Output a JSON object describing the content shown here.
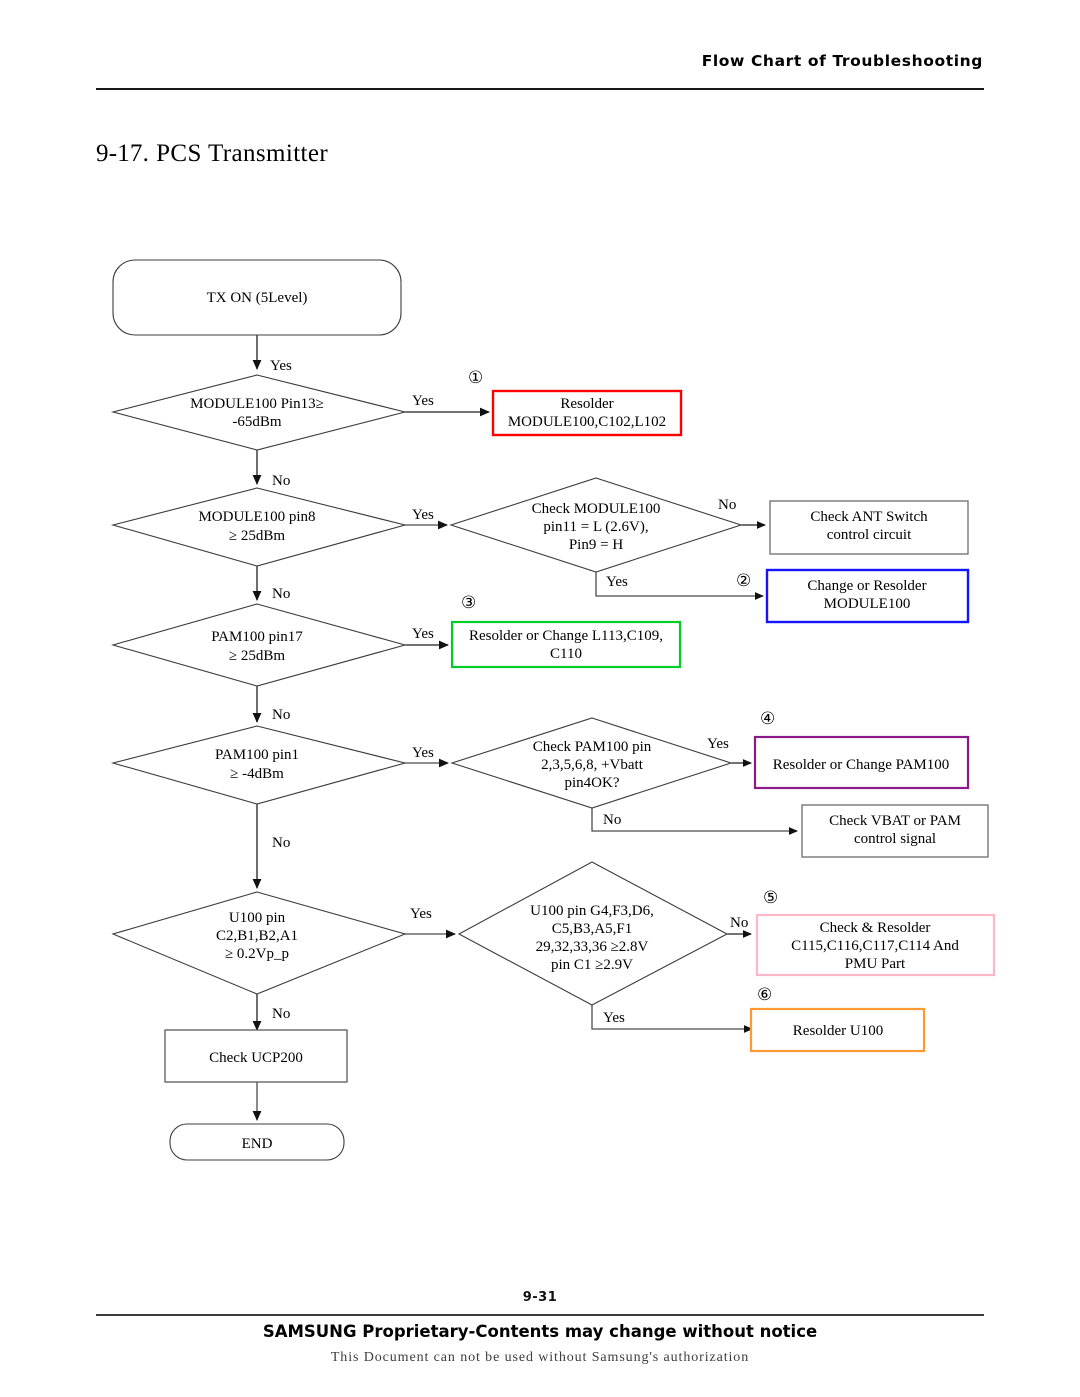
{
  "header": {
    "title": "Flow Chart of Troubleshooting"
  },
  "section": {
    "number": "9-17.",
    "title": "PCS Transmitter"
  },
  "footer": {
    "page_number": "9-31",
    "proprietary": "SAMSUNG Proprietary-Contents may change without notice",
    "authorization": "This Document can not be used without Samsung's authorization"
  },
  "chart_data": {
    "type": "diagram",
    "title": "PCS Transmitter troubleshooting flow chart",
    "nodes": [
      {
        "id": "start",
        "shape": "terminator",
        "lines": [
          "TX ON (5Level)"
        ]
      },
      {
        "id": "d1",
        "shape": "decision",
        "lines": [
          "MODULE100 Pin13≥",
          "-65dBm"
        ]
      },
      {
        "id": "d2",
        "shape": "decision",
        "lines": [
          "MODULE100 pin8",
          "≥ 25dBm"
        ]
      },
      {
        "id": "d3",
        "shape": "decision",
        "lines": [
          "PAM100 pin17",
          "≥ 25dBm"
        ]
      },
      {
        "id": "d4",
        "shape": "decision",
        "lines": [
          "PAM100 pin1",
          "≥ -4dBm"
        ]
      },
      {
        "id": "d5",
        "shape": "decision",
        "lines": [
          "U100 pin",
          "C2,B1,B2,A1",
          "≥ 0.2Vp_p"
        ]
      },
      {
        "id": "dm1",
        "shape": "decision",
        "lines": [
          "Check MODULE100",
          "pin11 = L (2.6V),",
          "Pin9 = H"
        ]
      },
      {
        "id": "dm2",
        "shape": "decision",
        "lines": [
          "Check PAM100 pin",
          "2,3,5,6,8, +Vbatt",
          "pin4OK?"
        ]
      },
      {
        "id": "dm3",
        "shape": "decision",
        "lines": [
          "U100 pin G4,F3,D6,",
          "C5,B3,A5,F1",
          "29,32,33,36 ≥2.8V",
          "pin C1 ≥2.9V"
        ]
      },
      {
        "id": "r1",
        "shape": "process",
        "lines": [
          "Resolder",
          "MODULE100,C102,L102"
        ],
        "color": "#ff0000",
        "marker": "①"
      },
      {
        "id": "ant",
        "shape": "process",
        "lines": [
          "Check ANT Switch",
          "control circuit"
        ],
        "color": "#555555"
      },
      {
        "id": "r2",
        "shape": "process",
        "lines": [
          "Change or Resolder",
          "MODULE100"
        ],
        "color": "#1414ff",
        "marker": "②"
      },
      {
        "id": "r3",
        "shape": "process",
        "lines": [
          "Resolder or Change L113,C109,",
          "C110"
        ],
        "color": "#00cc2a",
        "marker": "③"
      },
      {
        "id": "r4",
        "shape": "process",
        "lines": [
          "Resolder or Change PAM100"
        ],
        "color": "#8a1a8a",
        "marker": "④"
      },
      {
        "id": "vbat",
        "shape": "process",
        "lines": [
          "Check VBAT or PAM",
          "control signal"
        ],
        "color": "#555555"
      },
      {
        "id": "r5",
        "shape": "process",
        "lines": [
          "Check & Resolder",
          "C115,C116,C117,C114 And",
          "PMU Part"
        ],
        "color": "#ffb6c8",
        "marker": "⑤"
      },
      {
        "id": "r6",
        "shape": "process",
        "lines": [
          "Resolder U100"
        ],
        "color": "#ff9933",
        "marker": "⑥"
      },
      {
        "id": "ucp",
        "shape": "process",
        "lines": [
          "Check UCP200"
        ],
        "color": "#555555"
      },
      {
        "id": "end",
        "shape": "terminator",
        "lines": [
          "END"
        ]
      }
    ],
    "edges": [
      {
        "from": "start",
        "to": "d1",
        "label": "Yes"
      },
      {
        "from": "d1",
        "to": "r1",
        "label": "Yes"
      },
      {
        "from": "d1",
        "to": "d2",
        "label": "No"
      },
      {
        "from": "d2",
        "to": "dm1",
        "label": "Yes"
      },
      {
        "from": "d2",
        "to": "d3",
        "label": "No"
      },
      {
        "from": "dm1",
        "to": "ant",
        "label": "No"
      },
      {
        "from": "dm1",
        "to": "r2",
        "label": "Yes"
      },
      {
        "from": "d3",
        "to": "r3",
        "label": "Yes"
      },
      {
        "from": "d3",
        "to": "d4",
        "label": "No"
      },
      {
        "from": "d4",
        "to": "dm2",
        "label": "Yes"
      },
      {
        "from": "d4",
        "to": "d5",
        "label": "No"
      },
      {
        "from": "dm2",
        "to": "r4",
        "label": "Yes"
      },
      {
        "from": "dm2",
        "to": "vbat",
        "label": "No"
      },
      {
        "from": "d5",
        "to": "dm3",
        "label": "Yes"
      },
      {
        "from": "d5",
        "to": "ucp",
        "label": "No"
      },
      {
        "from": "dm3",
        "to": "r5",
        "label": "No"
      },
      {
        "from": "dm3",
        "to": "r6",
        "label": "Yes"
      },
      {
        "from": "ucp",
        "to": "end",
        "label": ""
      }
    ],
    "markers": [
      "①",
      "②",
      "③",
      "④",
      "⑤",
      "⑥"
    ]
  },
  "nodes": {
    "start": {
      "l0": "TX ON (5Level)"
    },
    "d1": {
      "l0": "MODULE100 Pin13≥",
      "l1": "-65dBm"
    },
    "d2": {
      "l0": "MODULE100 pin8",
      "l1": "≥ 25dBm"
    },
    "d3": {
      "l0": "PAM100 pin17",
      "l1": "≥ 25dBm"
    },
    "d4": {
      "l0": "PAM100 pin1",
      "l1": "≥ -4dBm"
    },
    "d5": {
      "l0": "U100 pin",
      "l1": "C2,B1,B2,A1",
      "l2": "≥ 0.2Vp_p"
    },
    "dm1": {
      "l0": "Check MODULE100",
      "l1": "pin11 = L (2.6V),",
      "l2": "Pin9 = H"
    },
    "dm2": {
      "l0": "Check PAM100 pin",
      "l1": "2,3,5,6,8, +Vbatt",
      "l2": "pin4OK?"
    },
    "dm3": {
      "l0": "U100 pin G4,F3,D6,",
      "l1": "C5,B3,A5,F1",
      "l2": "29,32,33,36 ≥2.8V",
      "l3": "pin C1 ≥2.9V"
    },
    "r1": {
      "l0": "Resolder",
      "l1": "MODULE100,C102,L102"
    },
    "ant": {
      "l0": "Check ANT Switch",
      "l1": "control circuit"
    },
    "r2": {
      "l0": "Change or Resolder",
      "l1": "MODULE100"
    },
    "r3": {
      "l0": "Resolder or Change L113,C109,",
      "l1": "C110"
    },
    "r4": {
      "l0": "Resolder or Change PAM100"
    },
    "vbat": {
      "l0": "Check VBAT or PAM",
      "l1": "control signal"
    },
    "r5": {
      "l0": "Check & Resolder",
      "l1": "C115,C116,C117,C114 And",
      "l2": "PMU Part"
    },
    "r6": {
      "l0": "Resolder U100"
    },
    "ucp": {
      "l0": "Check UCP200"
    },
    "end": {
      "l0": "END"
    }
  },
  "labels": {
    "yes": "Yes",
    "no": "No",
    "e_start_d1": "Yes",
    "e_d1_r1": "Yes",
    "e_d1_d2": "No",
    "e_d2_dm1": "Yes",
    "e_d2_d3": "No",
    "e_dm1_ant": "No",
    "e_dm1_r2": "Yes",
    "e_d3_r3": "Yes",
    "e_d3_d4": "No",
    "e_d4_dm2": "Yes",
    "e_d4_d5": "No",
    "e_dm2_r4": "Yes",
    "e_dm2_vbat": "No",
    "e_d5_dm3": "Yes",
    "e_d5_ucp": "No",
    "e_dm3_r5": "No",
    "e_dm3_r6": "Yes"
  },
  "markers": {
    "m1": "①",
    "m2": "②",
    "m3": "③",
    "m4": "④",
    "m5": "⑤",
    "m6": "⑥"
  },
  "colors": {
    "red": "#ff0000",
    "blue": "#1414ff",
    "green": "#00cc2a",
    "purple": "#8a1a8a",
    "pink": "#ffb6c8",
    "orange": "#ff9933",
    "gray": "#555555"
  }
}
